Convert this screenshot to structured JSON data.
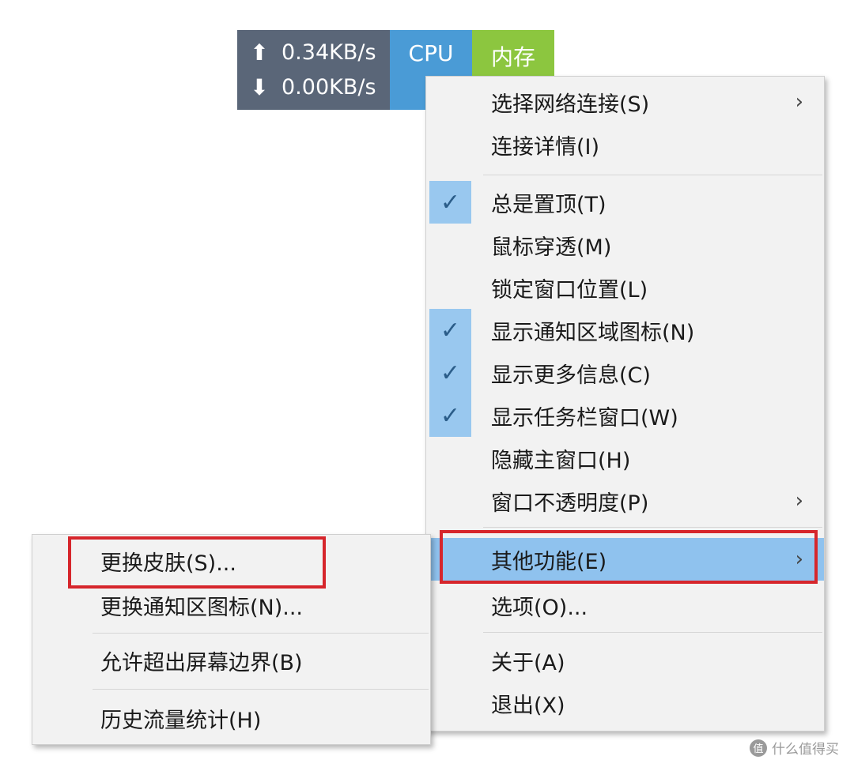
{
  "monitor": {
    "upload_speed": "0.34KB/s",
    "download_speed": "0.00KB/s",
    "cpu_label": "CPU",
    "memory_label": "内存",
    "net_color": "#5a6678",
    "cpu_color": "#4a9bd6",
    "memory_color": "#8cc63f"
  },
  "main_menu": {
    "items": [
      {
        "label": "选择网络连接(S)",
        "checked": false,
        "submenu": true
      },
      {
        "label": "连接详情(I)",
        "checked": false,
        "submenu": false
      },
      {
        "label": "总是置顶(T)",
        "checked": true,
        "submenu": false
      },
      {
        "label": "鼠标穿透(M)",
        "checked": false,
        "submenu": false
      },
      {
        "label": "锁定窗口位置(L)",
        "checked": false,
        "submenu": false
      },
      {
        "label": "显示通知区域图标(N)",
        "checked": true,
        "submenu": false
      },
      {
        "label": "显示更多信息(C)",
        "checked": true,
        "submenu": false
      },
      {
        "label": "显示任务栏窗口(W)",
        "checked": true,
        "submenu": false
      },
      {
        "label": "隐藏主窗口(H)",
        "checked": false,
        "submenu": false
      },
      {
        "label": "窗口不透明度(P)",
        "checked": false,
        "submenu": true
      },
      {
        "label": "其他功能(E)",
        "checked": false,
        "submenu": true,
        "highlighted": true
      },
      {
        "label": "选项(O)...",
        "checked": false,
        "submenu": false
      },
      {
        "label": "关于(A)",
        "checked": false,
        "submenu": false
      },
      {
        "label": "退出(X)",
        "checked": false,
        "submenu": false
      }
    ],
    "check_glyph": "✓",
    "chevron_glyph": "›",
    "highlight_color": "#8fc2ee"
  },
  "sub_menu": {
    "items": [
      {
        "label": "更换皮肤(S)..."
      },
      {
        "label": "更换通知区图标(N)..."
      },
      {
        "label": "允许超出屏幕边界(B)"
      },
      {
        "label": "历史流量统计(H)"
      }
    ]
  },
  "annotation_color": "#d6262c",
  "watermark": {
    "badge": "值",
    "text": "什么值得买"
  }
}
